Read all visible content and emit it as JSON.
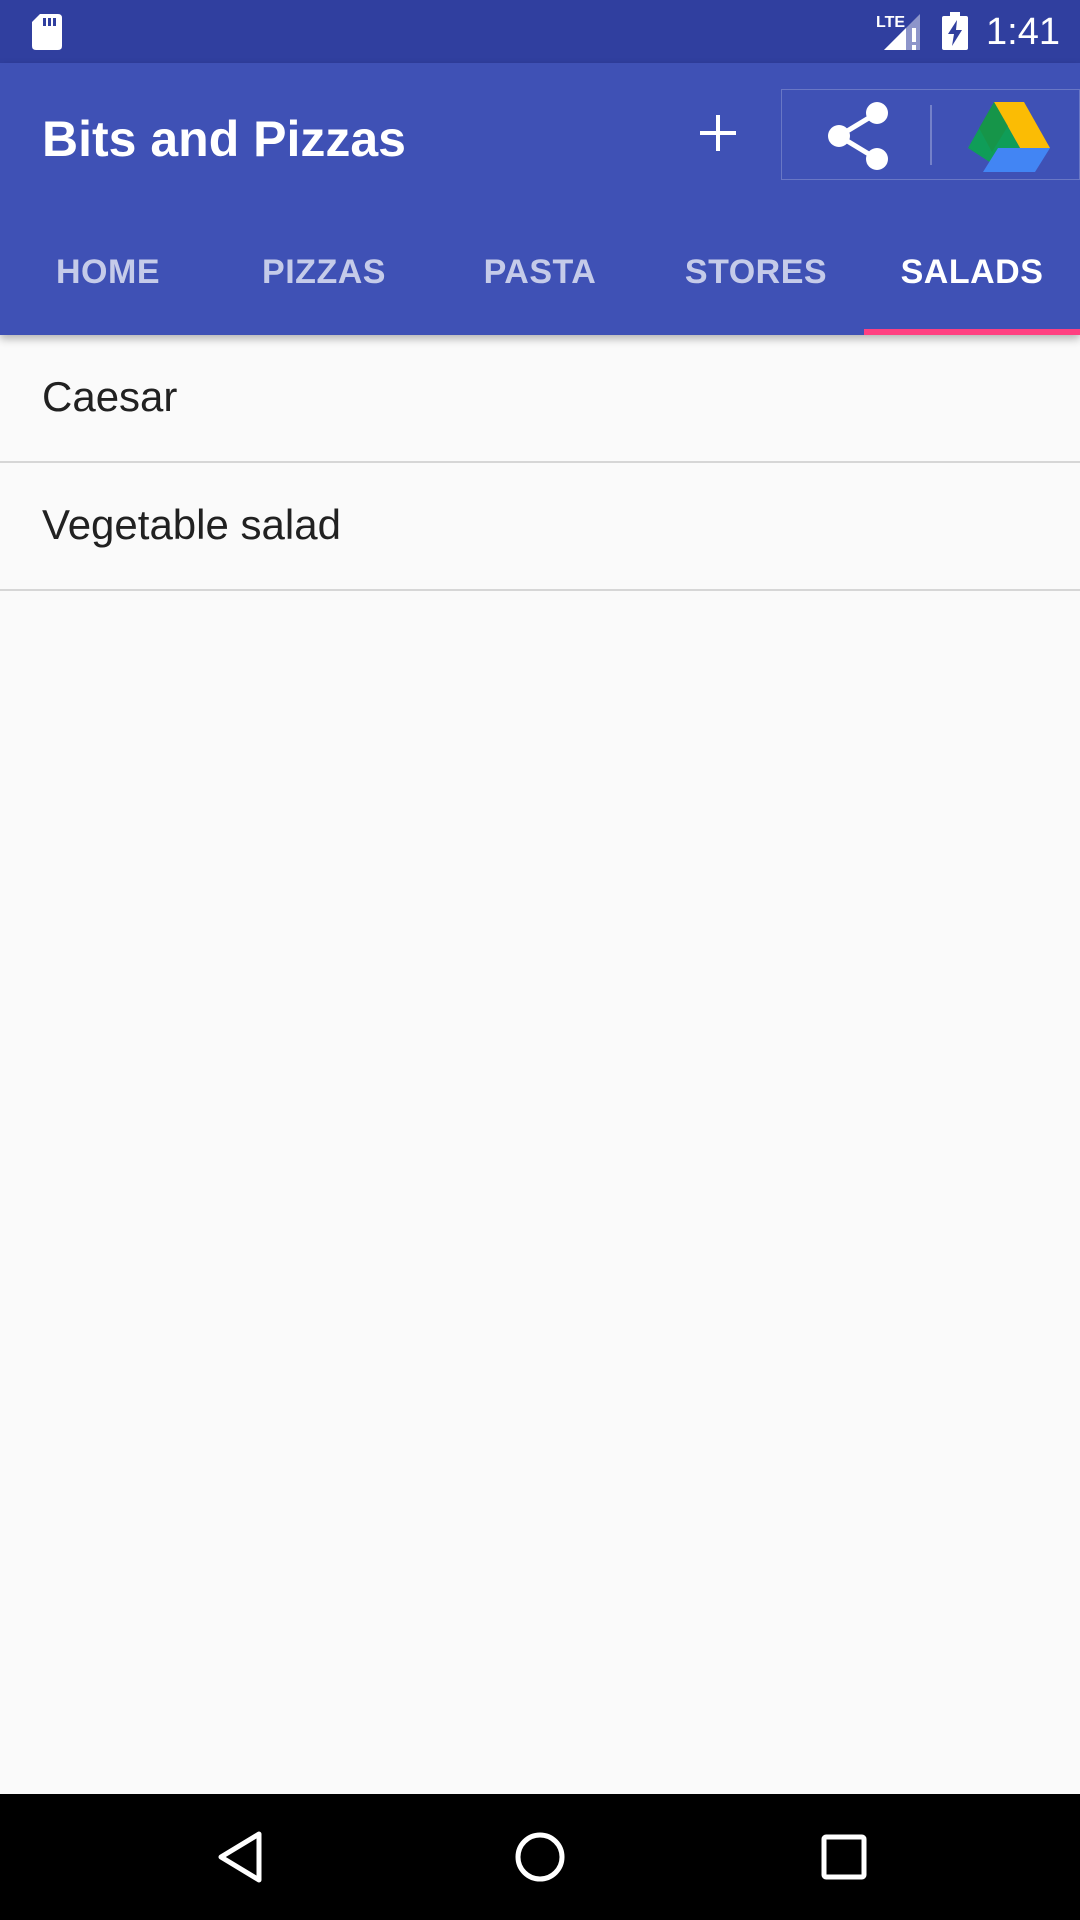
{
  "status_bar": {
    "time": "1:41",
    "network_label": "LTE",
    "icons": [
      "sd-card-icon",
      "signal-icon",
      "battery-charging-icon"
    ]
  },
  "toolbar": {
    "title": "Bits and Pizzas",
    "actions": [
      {
        "name": "add",
        "icon": "plus-icon"
      },
      {
        "name": "share",
        "icon": "share-icon"
      },
      {
        "name": "drive",
        "icon": "google-drive-icon"
      }
    ]
  },
  "tabs": {
    "items": [
      {
        "label": "HOME"
      },
      {
        "label": "PIZZAS"
      },
      {
        "label": "PASTA"
      },
      {
        "label": "STORES"
      },
      {
        "label": "SALADS"
      }
    ],
    "active_index": 4
  },
  "list": {
    "items": [
      {
        "label": "Caesar"
      },
      {
        "label": "Vegetable salad"
      }
    ]
  },
  "nav_bar": {
    "buttons": [
      "back-icon",
      "home-icon",
      "recents-icon"
    ]
  },
  "colors": {
    "status_bar": "#303f9f",
    "primary": "#3f51b5",
    "accent": "#ff4081",
    "background": "#fafafa",
    "text_primary": "#212121",
    "tab_inactive": "rgba(255,255,255,0.7)"
  }
}
